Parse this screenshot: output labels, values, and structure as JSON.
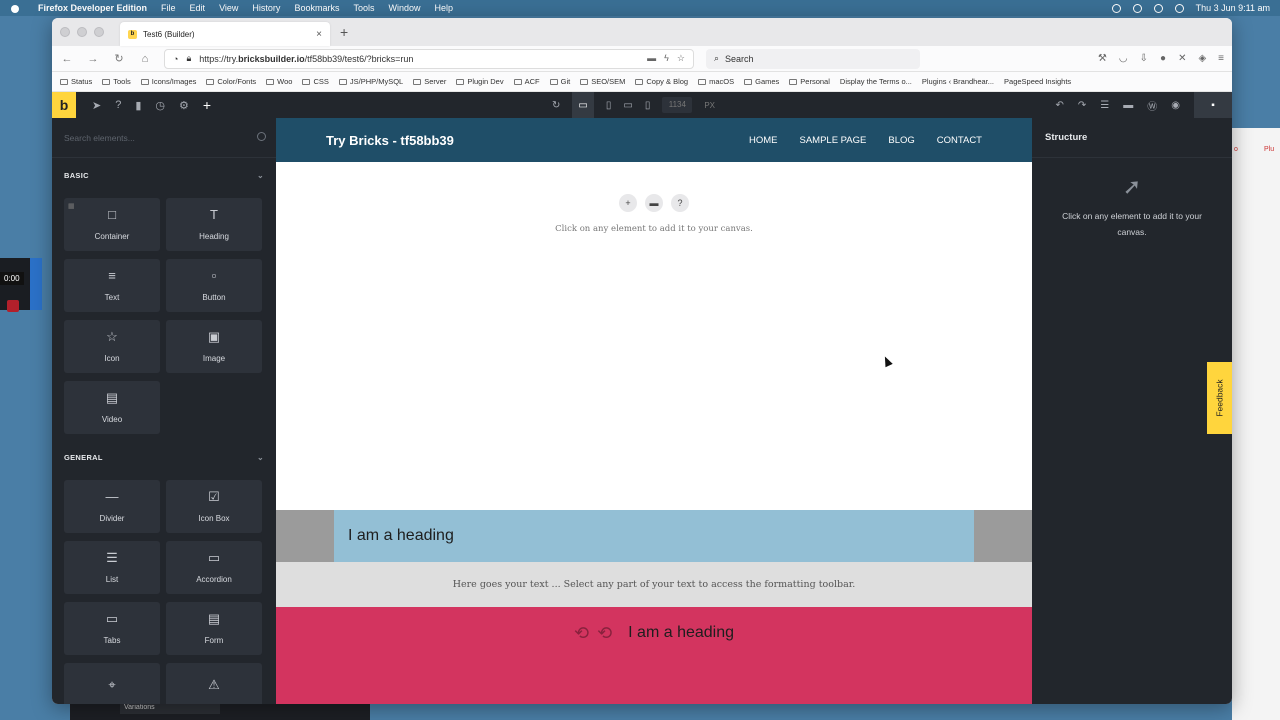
{
  "menubar": {
    "app": "Firefox Developer Edition",
    "items": [
      "File",
      "Edit",
      "View",
      "History",
      "Bookmarks",
      "Tools",
      "Window",
      "Help"
    ],
    "clock": "Thu 3 Jun  9:11 am"
  },
  "desktop": {
    "timer": "0:00",
    "bottom_label": "Variations",
    "right_tab_labels": [
      "o",
      "Plu"
    ]
  },
  "browser": {
    "tab_title": "Test6 (Builder)",
    "url_prefix": "https://try.",
    "url_domain": "bricksbuilder.io",
    "url_path": "/tf58bb39/test6/?bricks=run",
    "search_placeholder": "Search",
    "bookmarks": [
      "Status",
      "Tools",
      "Icons/Images",
      "Color/Fonts",
      "Woo",
      "CSS",
      "JS/PHP/MySQL",
      "Server",
      "Plugin Dev",
      "ACF",
      "Git",
      "SEO/SEM",
      "Copy & Blog",
      "macOS",
      "Games",
      "Personal",
      "Display the Terms o...",
      "Plugins ‹ Brandhear...",
      "PageSpeed Insights"
    ]
  },
  "builder": {
    "brand": "b",
    "width_value": "1134",
    "width_unit": "PX",
    "search_placeholder": "Search elements...",
    "categories": [
      {
        "name": "BASIC",
        "elements": [
          {
            "label": "Container",
            "icon": "□"
          },
          {
            "label": "Heading",
            "icon": "T"
          },
          {
            "label": "Text",
            "icon": "≡"
          },
          {
            "label": "Button",
            "icon": "▫"
          },
          {
            "label": "Icon",
            "icon": "☆"
          },
          {
            "label": "Image",
            "icon": "▣"
          },
          {
            "label": "Video",
            "icon": "▤"
          }
        ]
      },
      {
        "name": "GENERAL",
        "elements": [
          {
            "label": "Divider",
            "icon": "—"
          },
          {
            "label": "Icon Box",
            "icon": "☑"
          },
          {
            "label": "List",
            "icon": "☰"
          },
          {
            "label": "Accordion",
            "icon": "▭"
          },
          {
            "label": "Tabs",
            "icon": "▭"
          },
          {
            "label": "Form",
            "icon": "▤"
          },
          {
            "label": "",
            "icon": "⌖"
          },
          {
            "label": "",
            "icon": "⚠"
          }
        ]
      }
    ],
    "canvas": {
      "site_title": "Try Bricks - tf58bb39",
      "nav": [
        "HOME",
        "SAMPLE PAGE",
        "BLOG",
        "CONTACT"
      ],
      "hint": "Click on any element to add it to your canvas.",
      "section1_heading": "I am a heading",
      "section2_text": "Here goes your text ... Select any part of your text to access the formatting toolbar.",
      "section3_heading": "I am a heading"
    },
    "structure": {
      "title": "Structure",
      "hint": "Click on any element to add it to your canvas."
    },
    "feedback": "Feedback"
  },
  "colors": {
    "brand_yellow": "#ffd53d",
    "panel_dark": "#22262c",
    "header_blue": "#1f4e68",
    "heading_bg": "#93bfd5",
    "accent_red": "#d3345f"
  }
}
